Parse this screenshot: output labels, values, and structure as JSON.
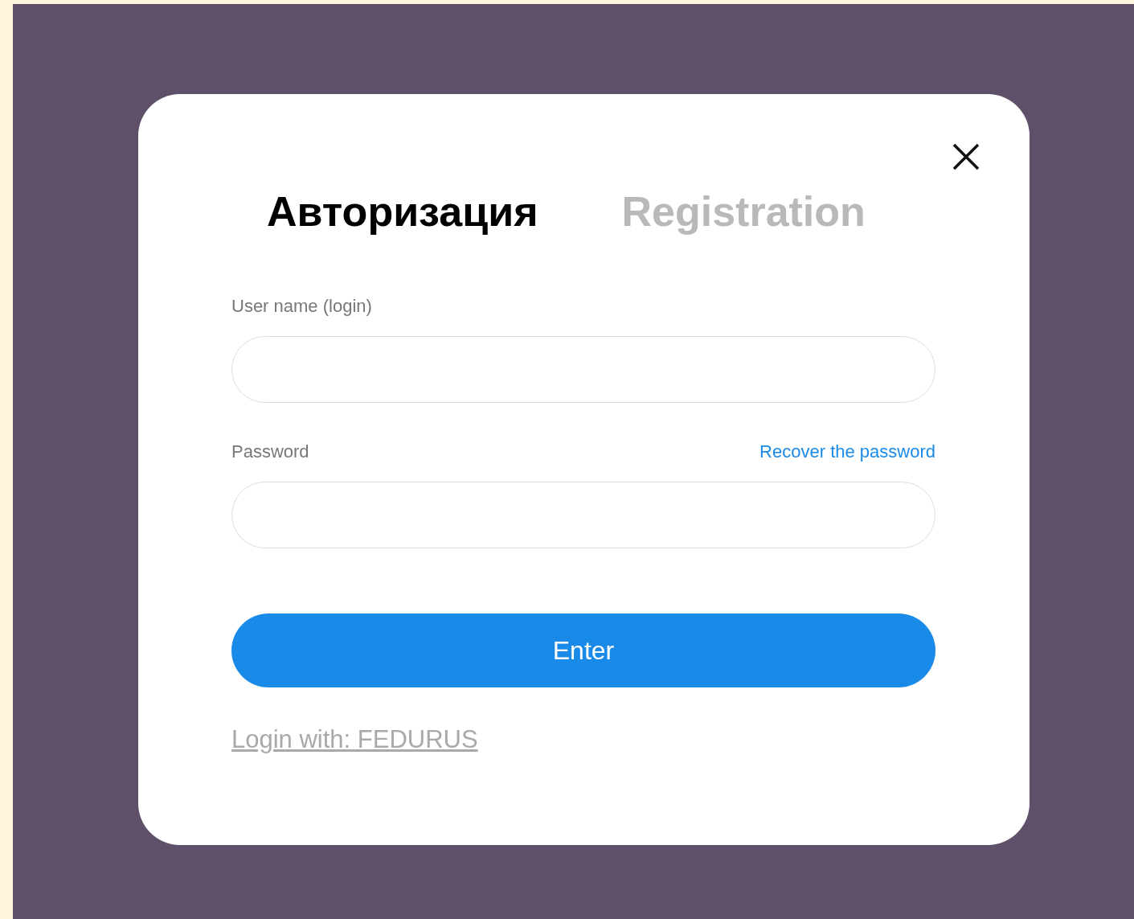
{
  "tabs": [
    {
      "label": "Авторизация",
      "selected": true
    },
    {
      "label": "Registration",
      "selected": false
    }
  ],
  "form": {
    "username_label": "User name (login)",
    "password_label": "Password",
    "recover_link": "Recover the password",
    "submit": "Enter",
    "alt_login": "Login with: FEDURUS"
  }
}
